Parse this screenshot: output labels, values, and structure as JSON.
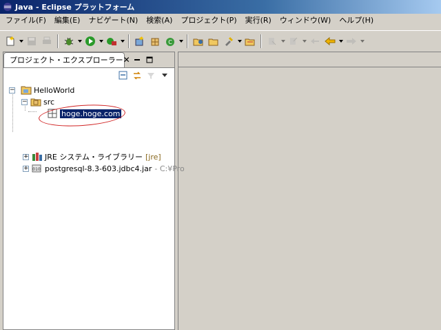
{
  "window": {
    "title": "Java - Eclipse プラットフォーム"
  },
  "menu": [
    {
      "label": "ファイル(F)"
    },
    {
      "label": "編集(E)"
    },
    {
      "label": "ナビゲート(N)"
    },
    {
      "label": "検索(A)"
    },
    {
      "label": "プロジェクト(P)"
    },
    {
      "label": "実行(R)"
    },
    {
      "label": "ウィンドウ(W)"
    },
    {
      "label": "ヘルプ(H)"
    }
  ],
  "view": {
    "tab_label": "プロジェクト・エクスプローラー",
    "close_symbol": "✕"
  },
  "tree": {
    "project": "HelloWorld",
    "src": "src",
    "package": "hoge.hoge.com",
    "jre_label": "JRE システム・ライブラリー",
    "jre_decoration": "[jre]",
    "jar_label": "postgresql-8.3-603.jdbc4.jar",
    "jar_decoration": "- C:¥Pro",
    "expander_plus": "+",
    "expander_minus": "−"
  },
  "colors": {
    "selection": "#0a246a",
    "annotation": "#d02020",
    "title_bar": "#0a246a"
  }
}
